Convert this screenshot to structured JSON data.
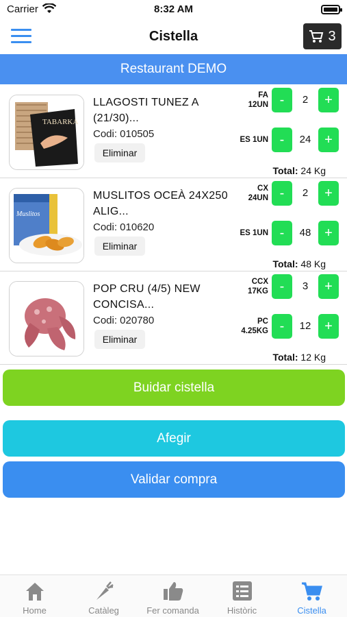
{
  "status": {
    "carrier": "Carrier",
    "time": "8:32 AM"
  },
  "nav": {
    "title": "Cistella",
    "cart_count": "3"
  },
  "restaurant": "Restaurant DEMO",
  "items": [
    {
      "name": "LLAGOSTI TUNEZ A (21/30)...",
      "code": "Codi: 010505",
      "remove": "Eliminar",
      "unit1": "FA\n12UN",
      "qty1": "2",
      "unit2": "ES 1UN",
      "qty2": "24",
      "total_label": "Total:",
      "total_value": " 24 Kg",
      "image_text": "TABARKA"
    },
    {
      "name": "MUSLITOS OCEÀ 24X250 ALIG...",
      "code": "Codi: 010620",
      "remove": "Eliminar",
      "unit1": "CX\n24UN",
      "qty1": "2",
      "unit2": "ES 1UN",
      "qty2": "48",
      "total_label": "Total:",
      "total_value": " 48 Kg",
      "image_text": "Muslitos"
    },
    {
      "name": "POP CRU (4/5) NEW CONCISA...",
      "code": "Codi: 020780",
      "remove": "Eliminar",
      "unit1": "CCX\n17KG",
      "qty1": "3",
      "unit2": "PC\n4.25KG",
      "qty2": "12",
      "total_label": "Total:",
      "total_value": " 12 Kg"
    }
  ],
  "buttons": {
    "clear": "Buidar cistella",
    "add": "Afegir",
    "validate": "Validar compra"
  },
  "colors": {
    "accent": "#4a90f0",
    "green": "#22dd55",
    "lime": "#7ed321",
    "cyan": "#1ec8e0",
    "blue": "#3a8ef0"
  },
  "tabs": [
    {
      "label": "Home",
      "icon": "home-icon"
    },
    {
      "label": "Catàleg",
      "icon": "carrot-icon"
    },
    {
      "label": "Fer comanda",
      "icon": "thumbs-up-icon"
    },
    {
      "label": "Històric",
      "icon": "list-icon"
    },
    {
      "label": "Cistella",
      "icon": "cart-icon"
    }
  ]
}
